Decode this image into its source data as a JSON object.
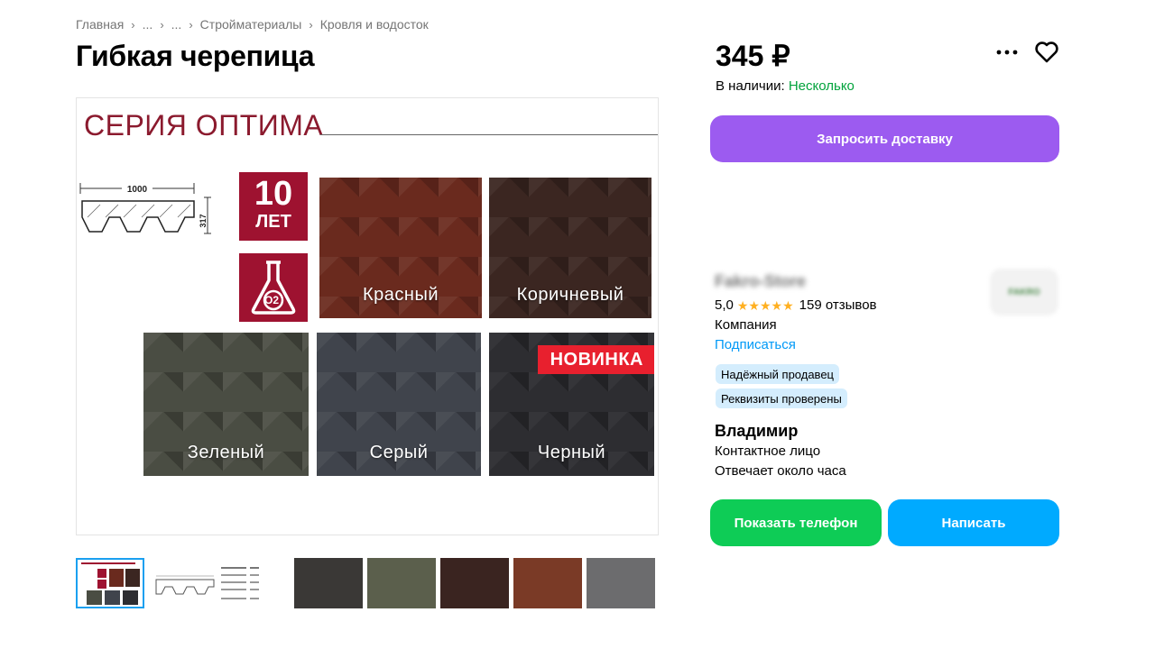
{
  "breadcrumb": {
    "items": [
      "Главная",
      "...",
      "...",
      "Стройматериалы",
      "Кровля и водосток"
    ],
    "separator": "›"
  },
  "product": {
    "title": "Гибкая черепица",
    "price": "345 ₽",
    "stock_label": "В наличии:",
    "stock_value": "Несколько",
    "deliver_button": "Запросить доставку"
  },
  "image": {
    "series_title": "СЕРИЯ ОПТИМА",
    "dimension_width": "1000",
    "dimension_height": "317",
    "badge_years_num": "10",
    "badge_years_unit": "ЛЕТ",
    "badge_o2": "O2",
    "new_badge": "НОВИНКА",
    "swatches": [
      "Красный",
      "Коричневый",
      "Зеленый",
      "Серый",
      "Черный"
    ]
  },
  "thumbnails": {
    "count": 7,
    "active_index": 0
  },
  "seller": {
    "name": "Fakro-Store",
    "logo_text": "FAKRO",
    "rating": "5,0",
    "star_count": 5,
    "reviews": "159 отзывов",
    "type": "Компания",
    "subscribe": "Подписаться",
    "tags": [
      "Надёжный продавец",
      "Реквизиты проверены"
    ]
  },
  "contact": {
    "name": "Владимир",
    "role": "Контактное лицо",
    "response": "Отвечает около часа",
    "phone_button": "Показать телефон",
    "write_button": "Написать"
  },
  "colors": {
    "accent_purple": "#9c5bf0",
    "accent_green": "#0ecc56",
    "accent_blue": "#00aaff",
    "link_blue": "#0099f7",
    "stock_green": "#02a33c",
    "brand_red": "#9e1230"
  }
}
